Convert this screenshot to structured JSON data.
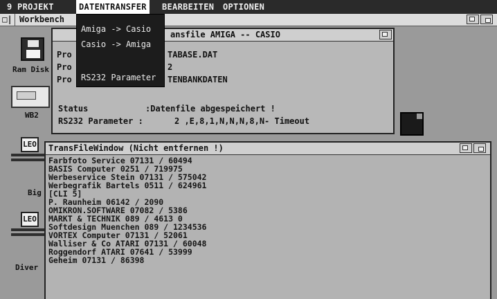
{
  "menubar": {
    "items": [
      {
        "label": "9 PROJEKT"
      },
      {
        "label": "DATENTRANSFER"
      },
      {
        "label": "BEARBEITEN"
      },
      {
        "label": "OPTIONEN"
      }
    ]
  },
  "workbench": {
    "close_glyph": "□|",
    "title": "Workbench"
  },
  "icons": {
    "ram_disk": "Ram Disk",
    "wb2": "WB2",
    "drawer1_plate": "LEO",
    "drawer1_label": "Big",
    "drawer2_plate": "LEO",
    "drawer2_label": "Diver"
  },
  "dialog": {
    "title": "ansfile AMIGA -- CASIO",
    "pro_labels": [
      "Pro",
      "Pro",
      "Pro"
    ],
    "pro_values": [
      "TABASE.DAT",
      "2",
      "TENBANKDATEN"
    ],
    "status_label": "Status",
    "status_value": ":Datenfile abgespeichert !",
    "rs232_label": "RS232 Parameter :",
    "rs232_value": "2 ,E,8,1,N,N,N,8,N- Timeout"
  },
  "dropdown": {
    "items": [
      "Amiga -> Casio",
      "Casio -> Amiga",
      "RS232 Parameter"
    ]
  },
  "transfile_window": {
    "title": "TransFileWindow (Nicht entfernen !)",
    "entries": [
      "Farbfoto Service 07131 / 60494",
      "BASIS Computer 0251 / 719975",
      "Werbeservice Stein 07131 / 575042",
      "Werbegrafik Bartels 0511 / 624961",
      "[CLI 5]",
      "P. Raunheim 06142 / 2090",
      "OMIKRON.SOFTWARE 07082 / 5386",
      "MARKT & TECHNIK 089 / 4613 0",
      "Softdesign Muenchen 089 / 1234536",
      "VORTEX Computer 07131 / 52061",
      "Walliser & Co ATARI 07131 / 60048",
      "Roggendorf ATARI 07641 / 53999",
      "Geheim 07131 / 86398"
    ]
  }
}
